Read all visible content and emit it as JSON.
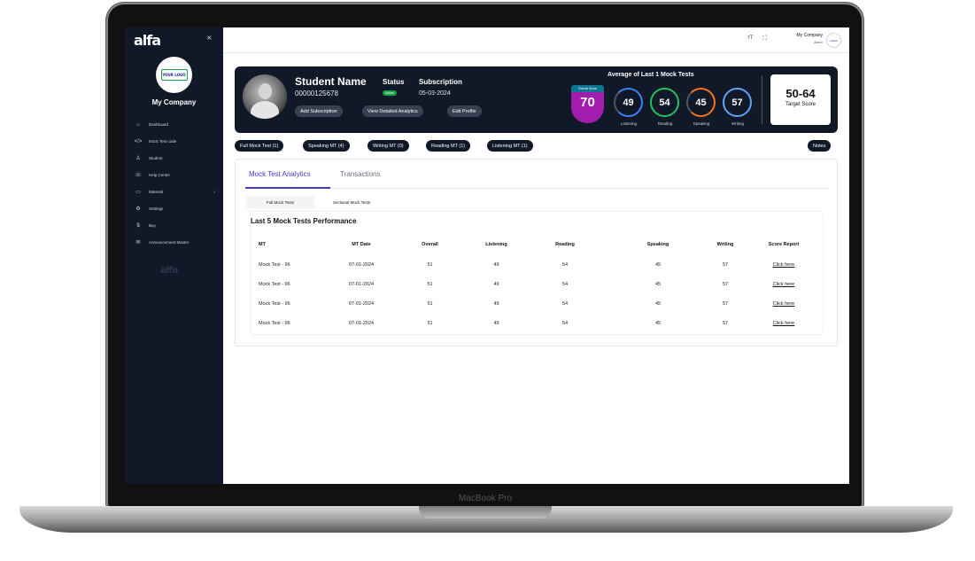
{
  "device": {
    "label": "MacBook Pro"
  },
  "sidebar": {
    "brand": "alfa",
    "close_icon": "×",
    "logo_text": "YOUR LOGO",
    "company": "My Company",
    "items": [
      {
        "label": "Dashboard",
        "icon": "⌂"
      },
      {
        "label": "Mock Test code",
        "icon": "</>"
      },
      {
        "label": "Student",
        "icon": "♙"
      },
      {
        "label": "Help Center",
        "icon": "☏"
      },
      {
        "label": "Material",
        "icon": "▭",
        "caret": "›"
      },
      {
        "label": "Settings",
        "icon": "⚙"
      },
      {
        "label": "Buy",
        "icon": "$"
      },
      {
        "label": "Announcement Master",
        "icon": "✉"
      }
    ],
    "watermark": "alfa"
  },
  "topbar": {
    "font_size_icon": "тT",
    "expand_icon": "⛶",
    "user_name": "My Company",
    "user_role": "Admin",
    "avatar_text": "LOGO"
  },
  "hero": {
    "student_name": "Student Name",
    "student_id": "00000125678",
    "status_label": "Status",
    "status_value": "Active",
    "subscription_label": "Subscription",
    "subscription_date": "05-03-2024",
    "buttons": {
      "add": "Add Subscription",
      "analytics": "View Detailed Analytics",
      "edit": "Edit Profile"
    },
    "avg_title": "Average of Last 1 Mock Tests",
    "overall_label": "Overall Score",
    "overall_value": "70",
    "scores": [
      {
        "value": "49",
        "label": "Listening",
        "color": "#3b82f6",
        "fraction": 0.49
      },
      {
        "value": "54",
        "label": "Reading",
        "color": "#22c55e",
        "fraction": 0.54
      },
      {
        "value": "45",
        "label": "Speaking",
        "color": "#f97316",
        "fraction": 0.45
      },
      {
        "value": "57",
        "label": "Writing",
        "color": "#60a5fa",
        "fraction": 0.57
      }
    ],
    "target_value": "50-64",
    "target_label": "Target Score"
  },
  "pills": [
    "Full Mock Test (1)",
    "Speaking MT (4)",
    "Writing MT (0)",
    "Reading MT (1)",
    "Listening MT (1)"
  ],
  "notes_label": "Notes",
  "tabs": {
    "active": "Mock Test Analytics",
    "inactive": "Transactions"
  },
  "subtabs": {
    "active": "Full Mock Tests",
    "inactive": "Sectional Mock Tests"
  },
  "performance_title": "Last 5 Mock Tests Performance",
  "table": {
    "headers": [
      "MT",
      "MT Date",
      "Overall",
      "Listening",
      "Reading",
      "Speaking",
      "Writing",
      "Score Report"
    ],
    "rows": [
      [
        "Mock Test - 96",
        "07-01-2024",
        "51",
        "49",
        "54",
        "45",
        "57",
        "Click here"
      ],
      [
        "Mock Test - 96",
        "07-01-2024",
        "51",
        "49",
        "54",
        "45",
        "57",
        "Click here"
      ],
      [
        "Mock Test - 96",
        "07-01-2024",
        "51",
        "49",
        "54",
        "45",
        "57",
        "Click here"
      ],
      [
        "Mock Test - 96",
        "07-01-2024",
        "51",
        "49",
        "54",
        "45",
        "57",
        "Click here"
      ]
    ]
  },
  "colors": {
    "sidebar_bg": "#111827",
    "accent": "#4338ca",
    "overall_bg": "#a21caf"
  }
}
